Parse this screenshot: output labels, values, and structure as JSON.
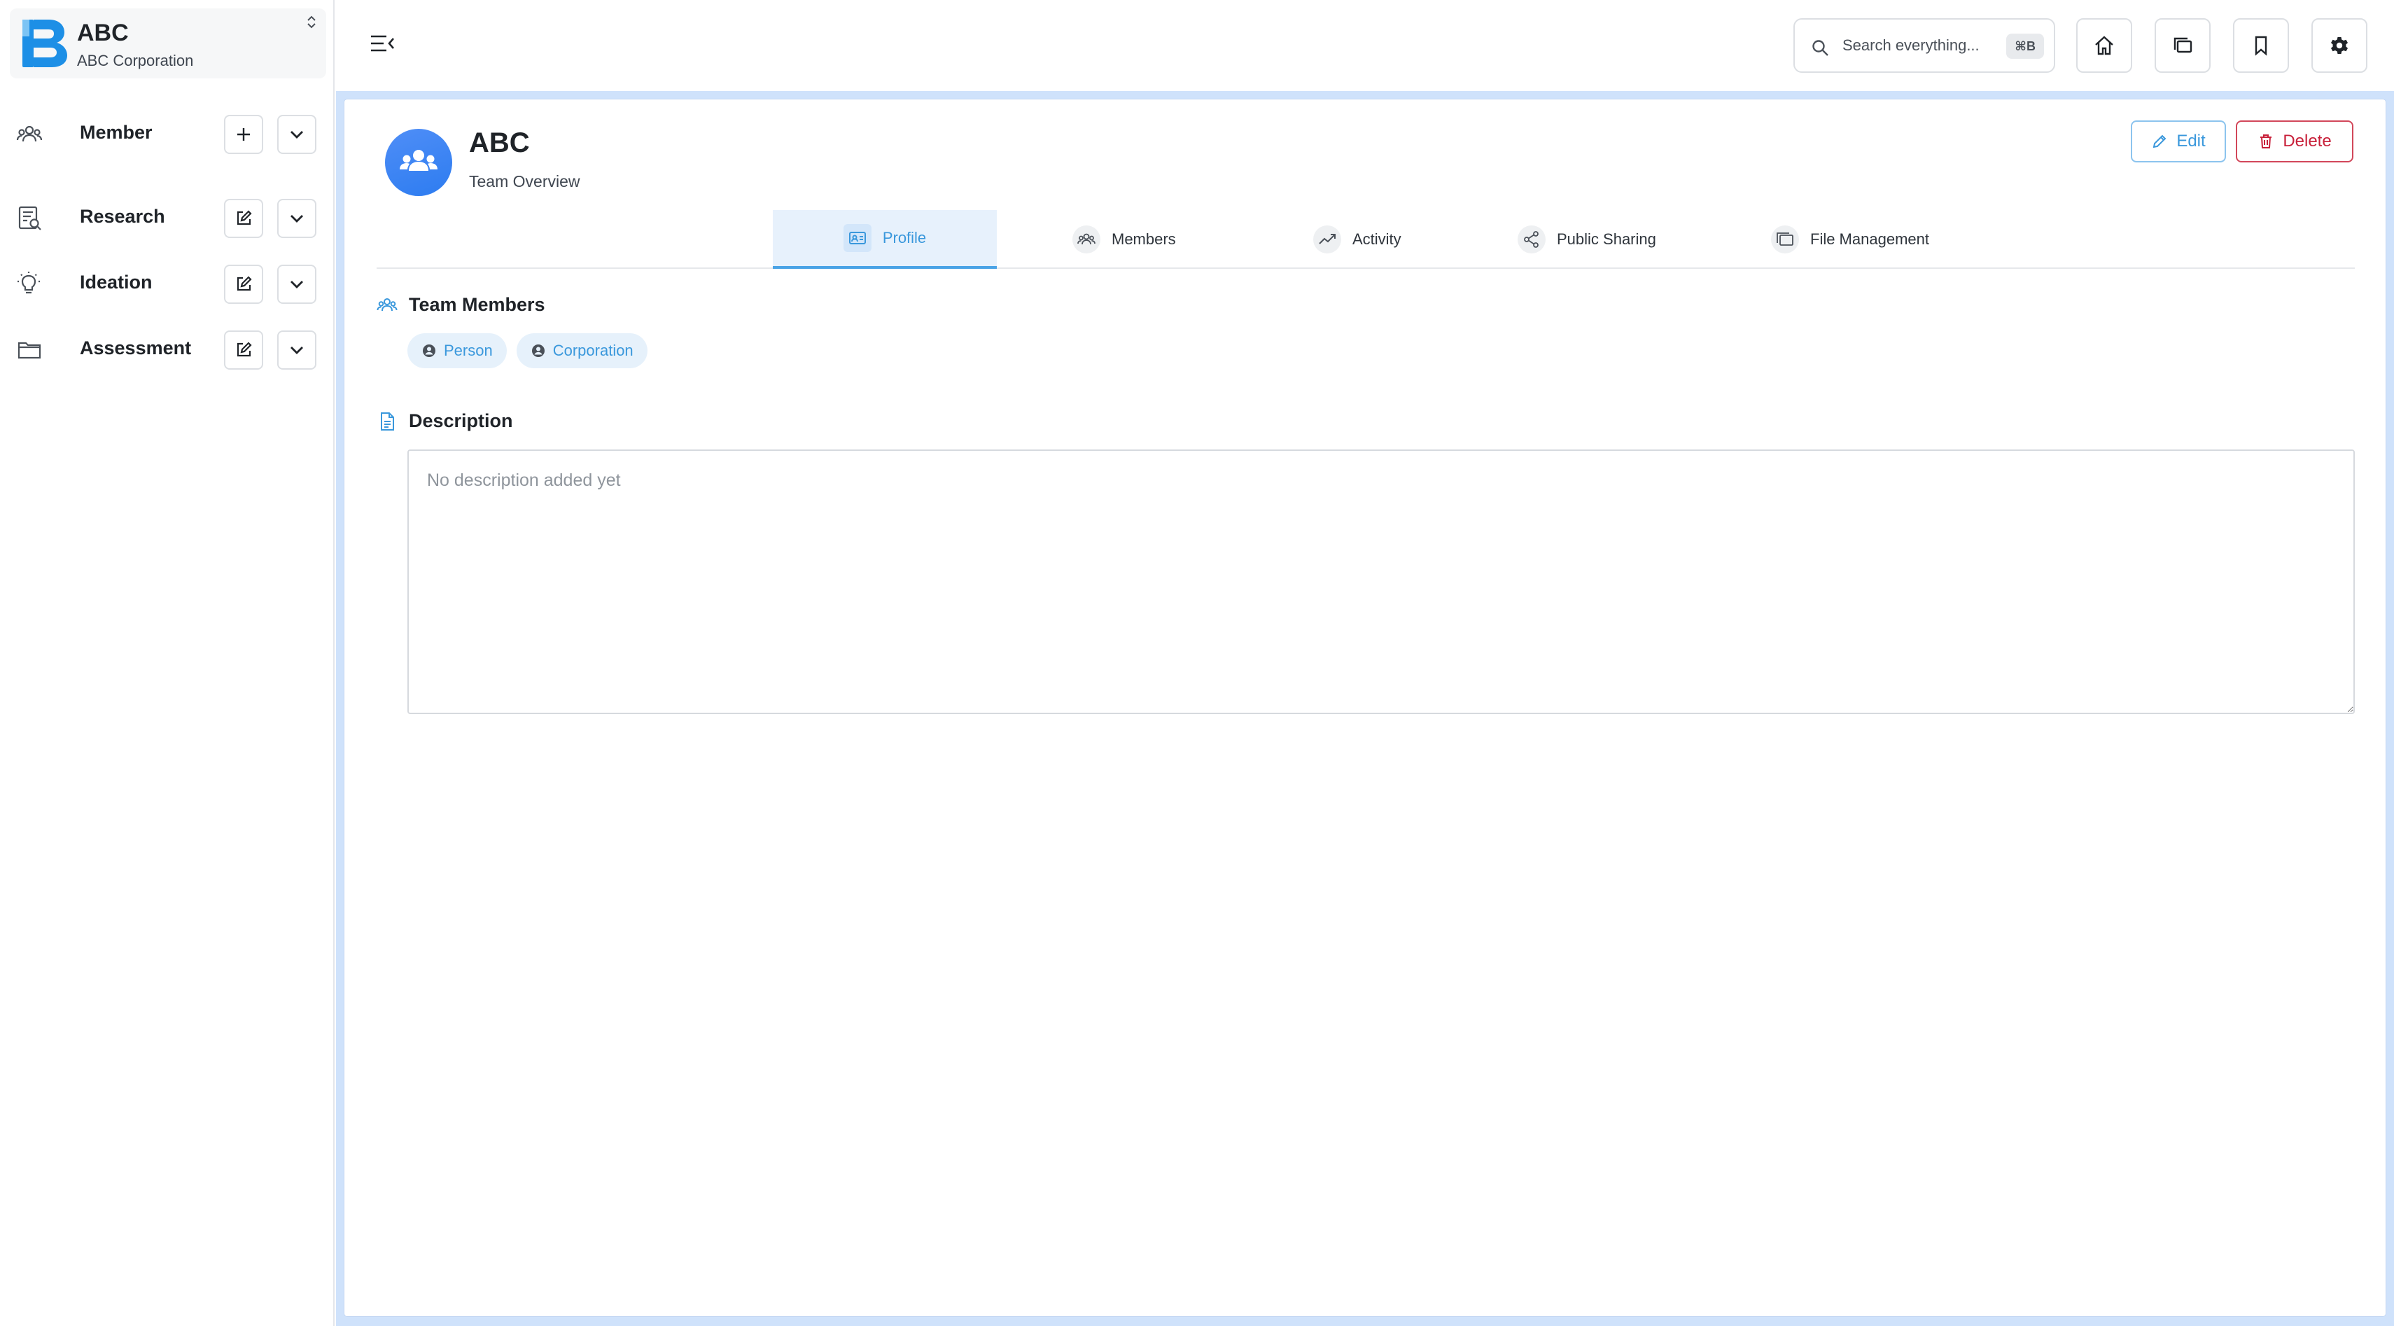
{
  "org": {
    "name": "ABC",
    "subtitle": "ABC Corporation"
  },
  "sidebar": {
    "items": [
      {
        "label": "Member",
        "icon": "people-icon",
        "action": "add-icon"
      },
      {
        "label": "Research",
        "icon": "research-icon",
        "action": "edit-icon"
      },
      {
        "label": "Ideation",
        "icon": "lightbulb-icon",
        "action": "edit-icon"
      },
      {
        "label": "Assessment",
        "icon": "folder-icon",
        "action": "edit-icon"
      }
    ]
  },
  "topbar": {
    "search_placeholder": "Search everything...",
    "search_shortcut": "⌘B"
  },
  "team": {
    "title": "ABC",
    "subtitle": "Team Overview"
  },
  "actions": {
    "edit_label": "Edit",
    "delete_label": "Delete"
  },
  "tabs": [
    {
      "label": "Profile",
      "active": true
    },
    {
      "label": "Members",
      "active": false
    },
    {
      "label": "Activity",
      "active": false
    },
    {
      "label": "Public Sharing",
      "active": false
    },
    {
      "label": "File Management",
      "active": false
    }
  ],
  "members_section": {
    "title": "Team Members",
    "chips": [
      "Person",
      "Corporation"
    ]
  },
  "description_section": {
    "title": "Description",
    "placeholder": "No description added yet"
  },
  "colors": {
    "accent": "#3a98dc",
    "danger": "#c8203a",
    "frame": "#cfe2fb"
  }
}
